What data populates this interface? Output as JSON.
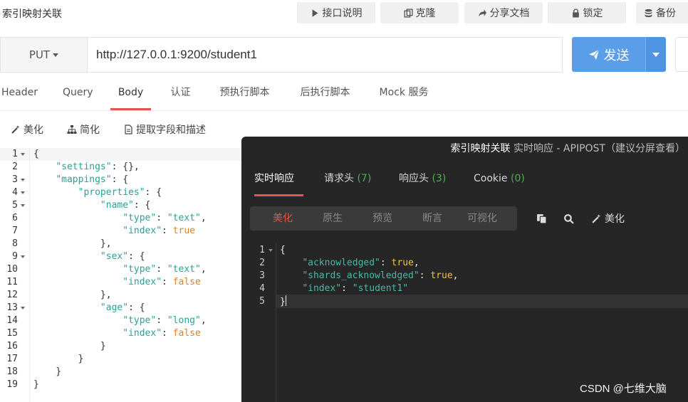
{
  "window": {
    "title": "索引映射关联"
  },
  "toolbar": {
    "doc_label": "接口说明",
    "clone_label": "克隆",
    "share_label": "分享文档",
    "lock_label": "锁定",
    "backup_label": "备份"
  },
  "request": {
    "method": "PUT",
    "url": "http://127.0.0.1:9200/student1",
    "send_label": "发送"
  },
  "request_tabs": [
    "Header",
    "Query",
    "Body",
    "认证",
    "预执行脚本",
    "后执行脚本",
    "Mock 服务"
  ],
  "active_request_tab": "Body",
  "body_tools": {
    "beautify": "美化",
    "simplify": "简化",
    "extract": "提取字段和描述"
  },
  "editor": {
    "line_numbers": [
      "1",
      "2",
      "3",
      "4",
      "5",
      "6",
      "7",
      "8",
      "9",
      "10",
      "11",
      "12",
      "13",
      "14",
      "15",
      "16",
      "17",
      "18",
      "19"
    ],
    "foldable_lines": [
      1,
      3,
      4,
      5,
      9,
      13
    ]
  },
  "response": {
    "header_title": "索引映射关联",
    "header_sub": "实时响应 - APIPOST（建议分屏查看）",
    "tabs": [
      {
        "label": "实时响应",
        "count": ""
      },
      {
        "label": "请求头",
        "count": "(7)"
      },
      {
        "label": "响应头",
        "count": "(3)"
      },
      {
        "label": "Cookie",
        "count": "(0)"
      }
    ],
    "view_modes": [
      "美化",
      "原生",
      "预览",
      "断言",
      "可视化"
    ],
    "active_view_mode": "美化",
    "beautify_label": "美化",
    "line_numbers": [
      "1",
      "2",
      "3",
      "4",
      "5"
    ]
  },
  "watermark": "CSDN @七维大脑",
  "colors": {
    "accent": "#e5534b",
    "send_button": "#5b9ee8",
    "panel_bg": "#262626",
    "json_key": "#2aa198",
    "json_bool": "#d9822b"
  }
}
